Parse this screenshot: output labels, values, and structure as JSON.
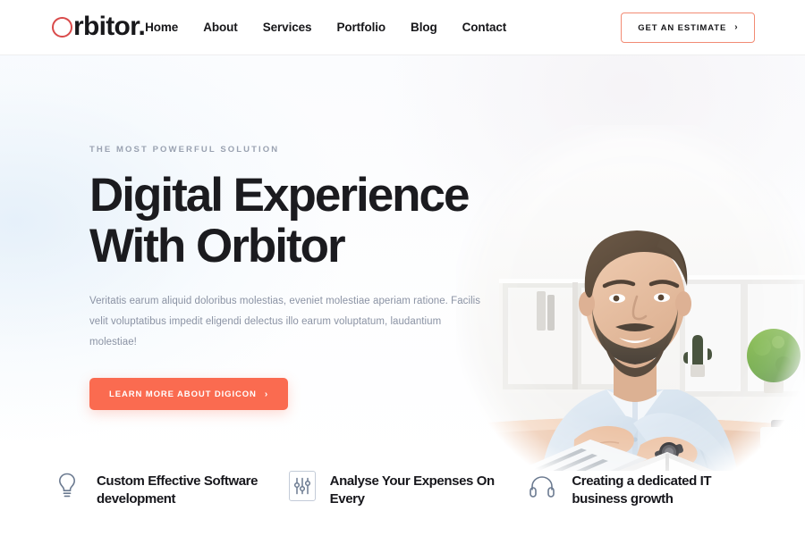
{
  "brand": {
    "logo_first_letter": "O",
    "logo_rest": "rbitor.",
    "logo_full": "Orbitor.",
    "accent_ring_color": "#d94a4a"
  },
  "header": {
    "nav": [
      {
        "label": "Home"
      },
      {
        "label": "About"
      },
      {
        "label": "Services"
      },
      {
        "label": "Portfolio"
      },
      {
        "label": "Blog"
      },
      {
        "label": "Contact"
      }
    ],
    "cta": {
      "label": "GET AN ESTIMATE",
      "arrow": "›",
      "border_color": "#f28b74"
    }
  },
  "hero": {
    "eyebrow": "THE MOST POWERFUL SOLUTION",
    "headline_line1": "Digital Experience",
    "headline_line2": "With Orbitor",
    "paragraph": "Veritatis earum aliquid doloribus molestias, eveniet molestiae aperiam ratione. Facilis velit voluptatibus impedit eligendi delectus illo earum voluptatum, laudantium molestiae!",
    "cta": {
      "label": "LEARN MORE ABOUT DIGICON",
      "arrow": "›",
      "background_color": "#fa6b50"
    },
    "image_alt": "Smiling bearded man in a light blue shirt working on a laptop at a desk in a bright white office"
  },
  "features": [
    {
      "icon": "lightbulb-icon",
      "title": "Custom Effective Software development"
    },
    {
      "icon": "equalizer-sliders-icon",
      "title": "Analyse Your Expenses On Every"
    },
    {
      "icon": "headphones-icon",
      "title": "Creating a dedicated IT business growth"
    }
  ]
}
